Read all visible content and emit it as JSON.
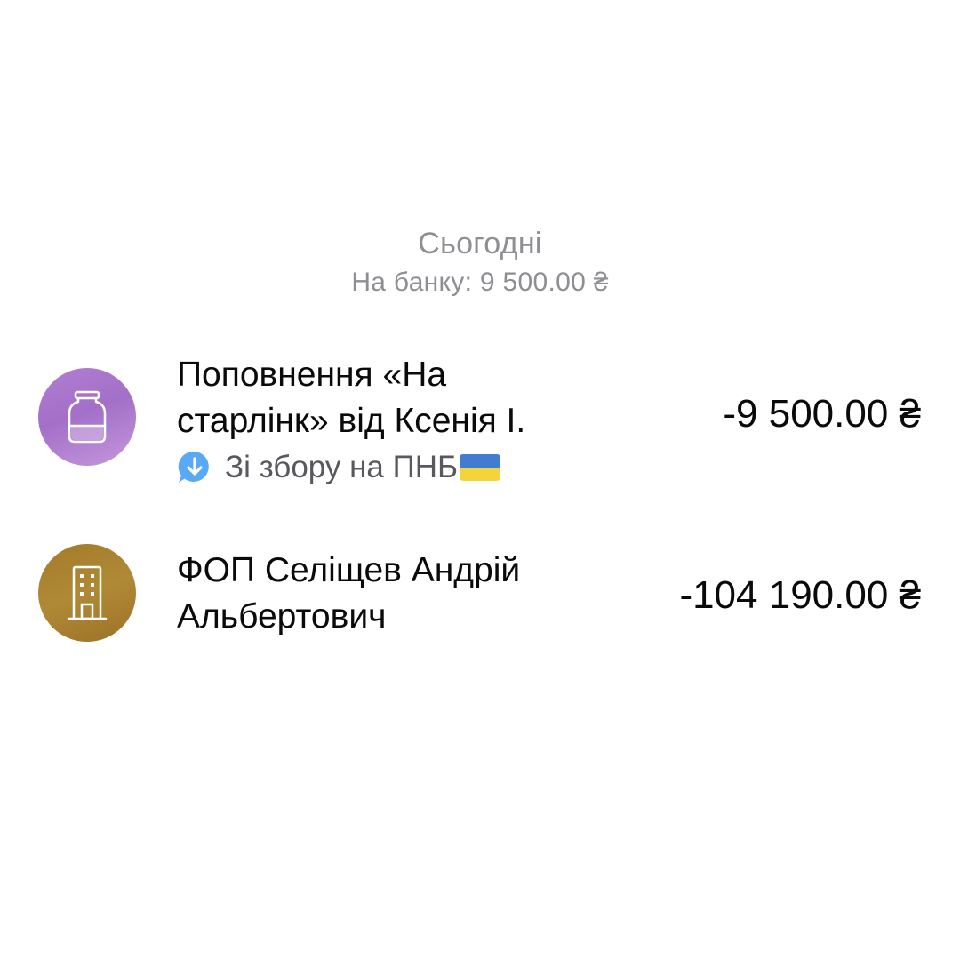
{
  "section": {
    "title": "Сьогодні",
    "subtitle": "На банку: 9 500.00 ₴"
  },
  "transactions": [
    {
      "icon": "jar-icon",
      "avatar_color": "#a36fc8",
      "title_line1": "Поповнення «На",
      "title_line2": "старлінк» від Ксенія І.",
      "comment": "Зі збору на ПНБ",
      "comment_flag": "ukraine-flag-icon",
      "amount": "-9 500.00 ₴"
    },
    {
      "icon": "building-icon",
      "avatar_color": "#a37b2a",
      "title_line1": "ФОП Селіщев Андрій",
      "title_line2": "Альбертович",
      "amount": "-104 190.00 ₴"
    }
  ],
  "colors": {
    "secondary_text": "#8e8e93",
    "comment_icon": "#3d9bf5",
    "flag_blue": "#1f66c8",
    "flag_yellow": "#f3cd1c"
  }
}
